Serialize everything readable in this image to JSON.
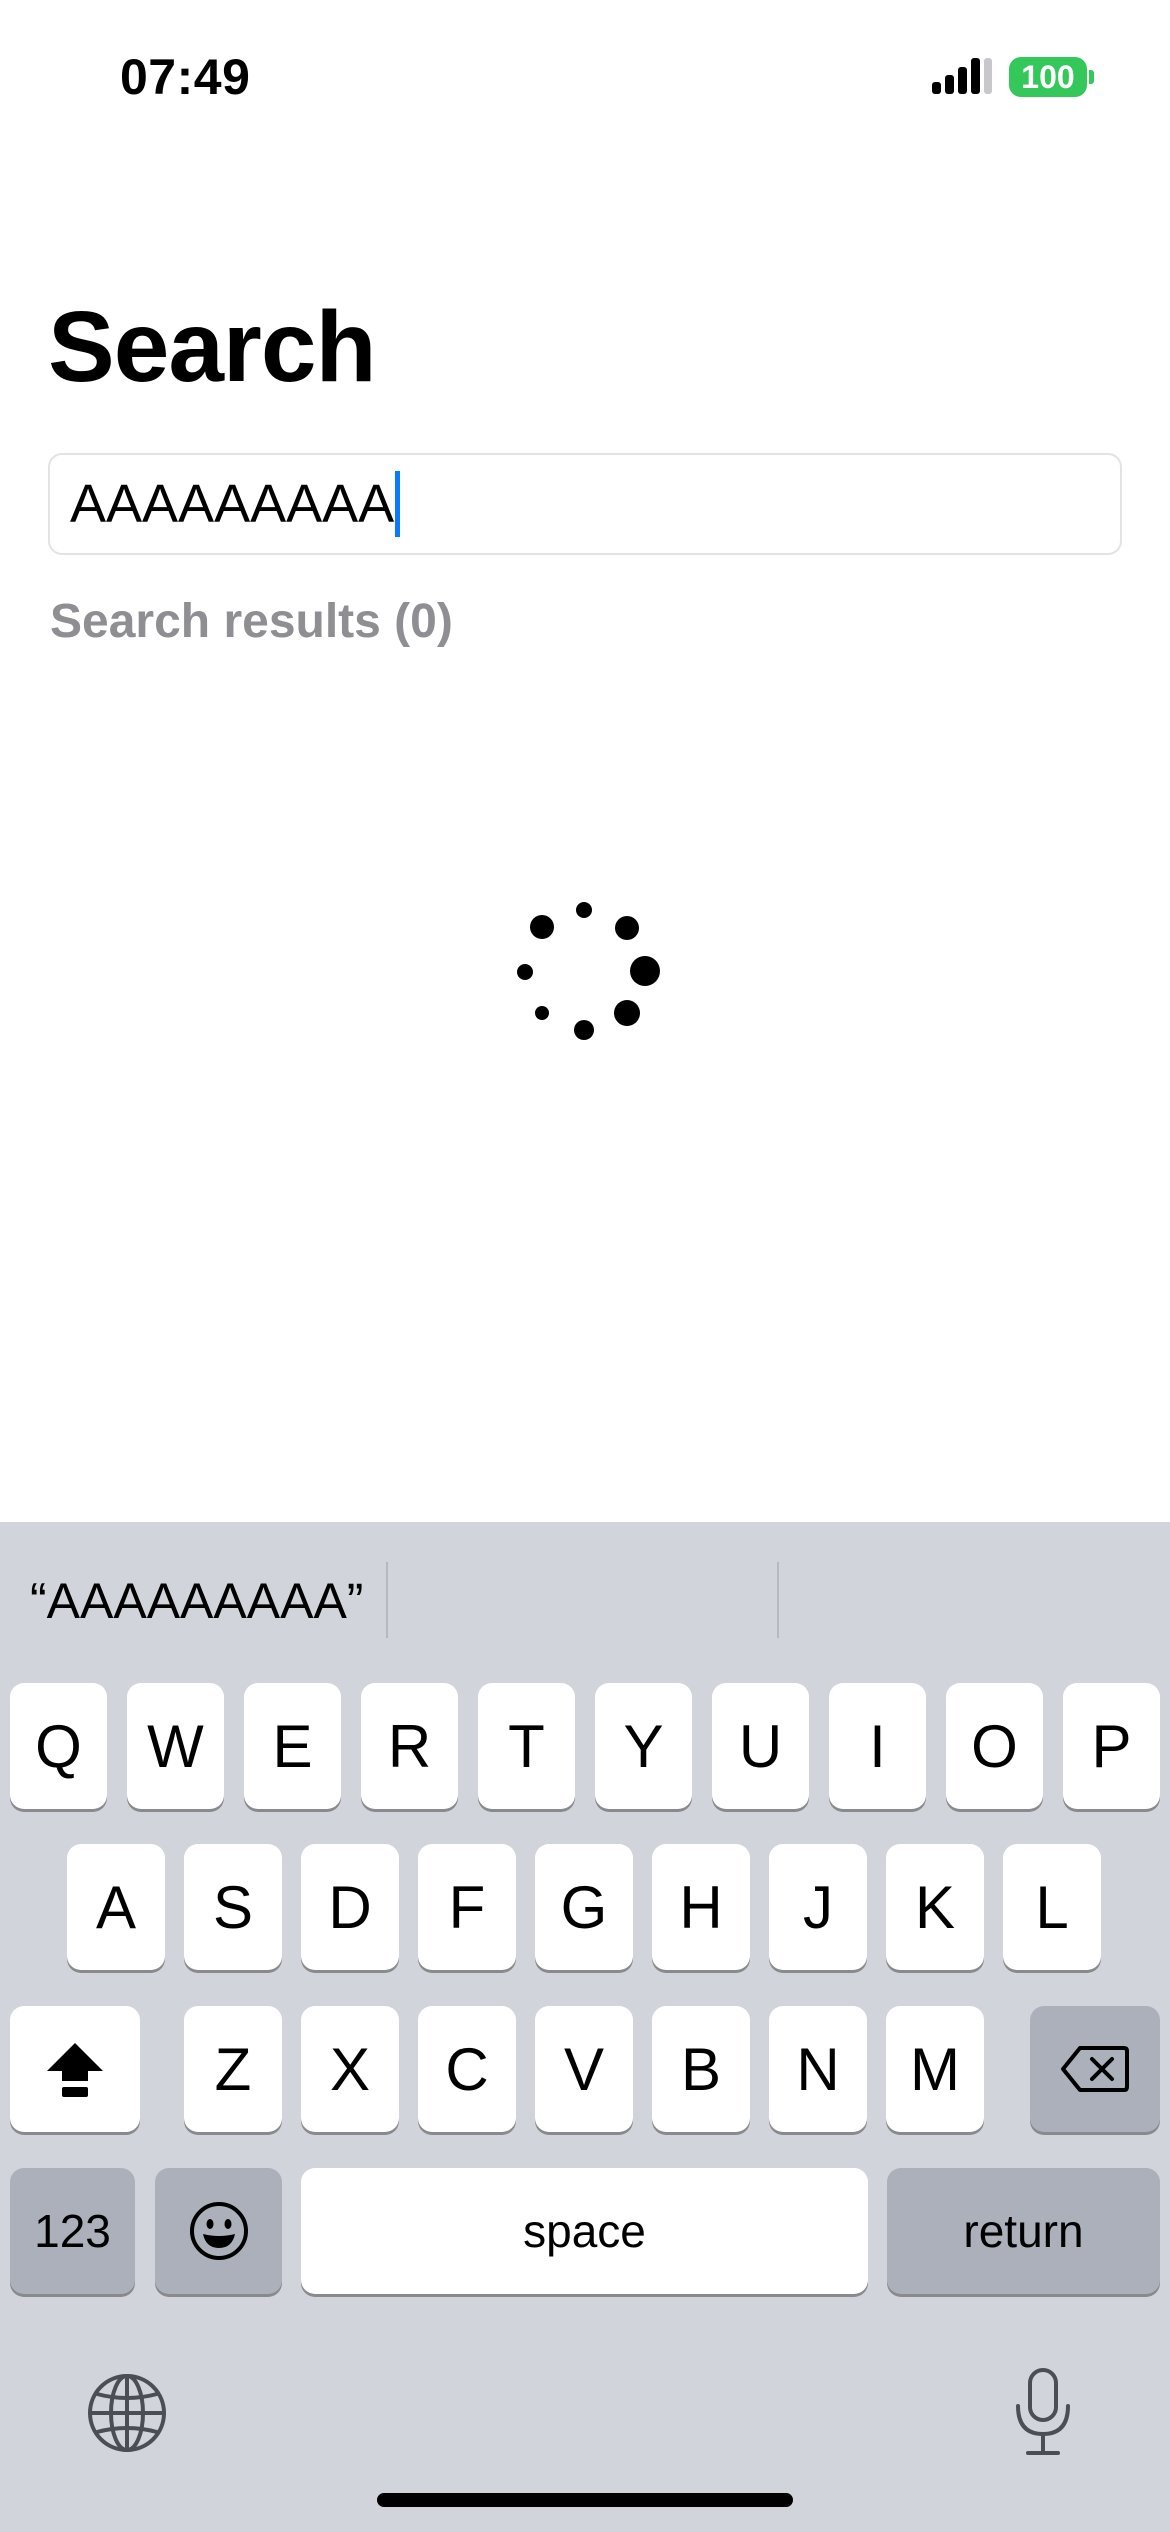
{
  "status_bar": {
    "time": "07:49",
    "battery": "100",
    "battery_color": "#34c759",
    "signal_icon": "cellular-signal-icon"
  },
  "page": {
    "title": "Search",
    "search_value": "AAAAAAAAA",
    "results_label": "Search results (0)",
    "loading_icon": "activity-spinner-icon"
  },
  "keyboard": {
    "suggestions": [
      "“AAAAAAAAA”",
      "",
      ""
    ],
    "row1": [
      "Q",
      "W",
      "E",
      "R",
      "T",
      "Y",
      "U",
      "I",
      "O",
      "P"
    ],
    "row2": [
      "A",
      "S",
      "D",
      "F",
      "G",
      "H",
      "J",
      "K",
      "L"
    ],
    "row3": [
      "Z",
      "X",
      "C",
      "V",
      "B",
      "N",
      "M"
    ],
    "numbers_label": "123",
    "space_label": "space",
    "return_label": "return",
    "icons": {
      "shift": "shift-icon",
      "backspace": "backspace-icon",
      "emoji": "emoji-icon",
      "globe": "globe-icon",
      "mic": "microphone-icon"
    }
  }
}
